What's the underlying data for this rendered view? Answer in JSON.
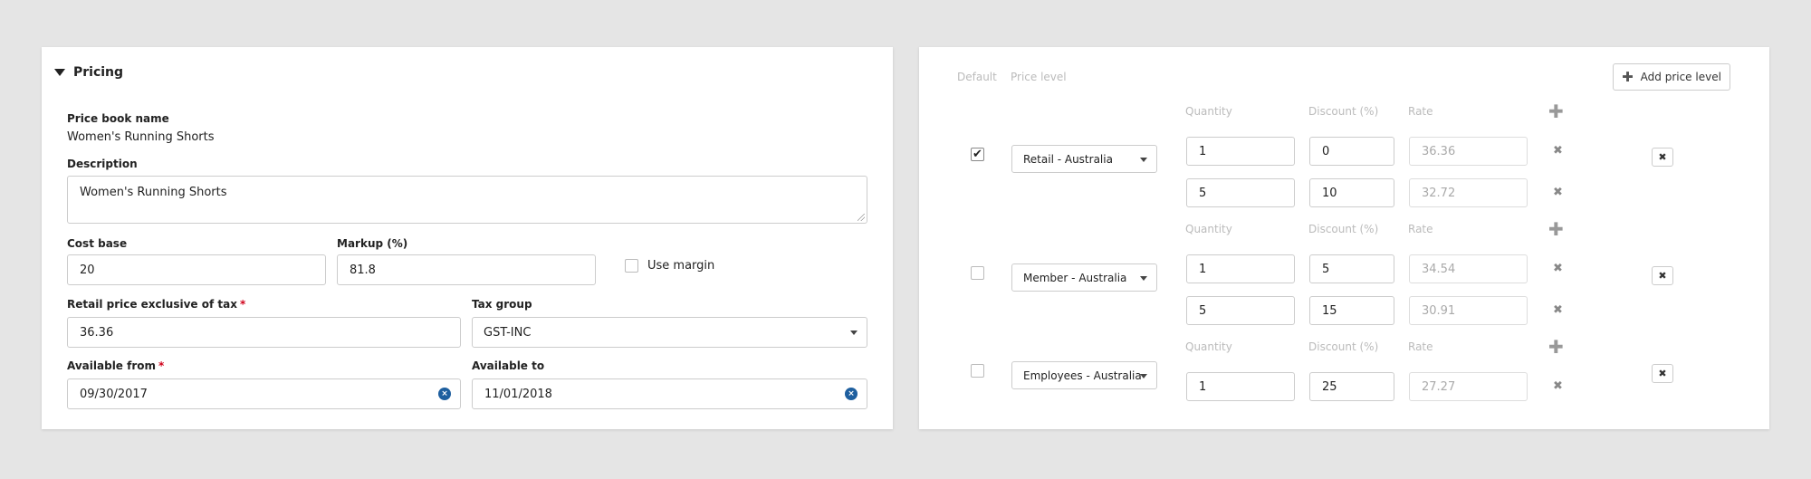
{
  "pricing": {
    "section_title": "Pricing",
    "price_book_name_label": "Price book name",
    "price_book_name_value": "Women's Running Shorts",
    "description_label": "Description",
    "description_value": "Women's Running Shorts",
    "cost_base_label": "Cost base",
    "cost_base_value": "20",
    "markup_label": "Markup (%)",
    "markup_value": "81.8",
    "use_margin_label": "Use margin",
    "retail_label": "Retail price exclusive of tax",
    "retail_value": "36.36",
    "tax_group_label": "Tax group",
    "tax_group_value": "GST-INC",
    "available_from_label": "Available from",
    "available_from_value": "09/30/2017",
    "available_to_label": "Available to",
    "available_to_value": "11/01/2018",
    "required_mark": "*",
    "clear_glyph": "×"
  },
  "price_levels": {
    "default_header": "Default",
    "price_level_header": "Price level",
    "add_button_label": "Add price level",
    "quantity_header": "Quantity",
    "discount_header": "Discount (%)",
    "rate_header": "Rate",
    "plus_glyph": "✚",
    "remove_glyph": "✖",
    "check_glyph": "✔",
    "levels": [
      {
        "name": "Retail - Australia",
        "default": true,
        "tiers": [
          {
            "quantity": "1",
            "discount": "0",
            "rate": "36.36"
          },
          {
            "quantity": "5",
            "discount": "10",
            "rate": "32.72"
          }
        ]
      },
      {
        "name": "Member - Australia",
        "default": false,
        "tiers": [
          {
            "quantity": "1",
            "discount": "5",
            "rate": "34.54"
          },
          {
            "quantity": "5",
            "discount": "15",
            "rate": "30.91"
          }
        ]
      },
      {
        "name": "Employees - Australia",
        "default": false,
        "tiers": [
          {
            "quantity": "1",
            "discount": "25",
            "rate": "27.27"
          }
        ]
      }
    ]
  },
  "colors": {
    "background": "#e5e5e5",
    "card": "#ffffff",
    "clear_button": "#1e5f9f",
    "required": "#d0021b"
  }
}
